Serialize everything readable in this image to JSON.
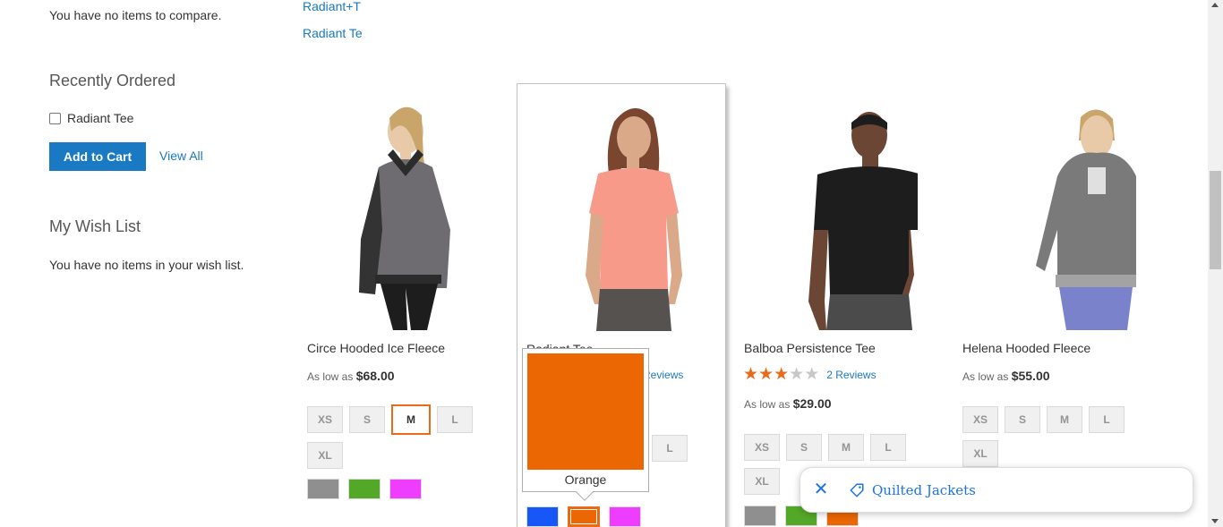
{
  "sidebar": {
    "compare_empty": "You have no items to compare.",
    "recently_ordered": {
      "title": "Recently Ordered",
      "item": "Radiant Tee",
      "add_to_cart": "Add to Cart",
      "view_all": "View All"
    },
    "wishlist": {
      "title": "My Wish List",
      "empty": "You have no items in your wish list."
    }
  },
  "top_links": [
    "Radiant+T",
    "Radiant Te"
  ],
  "products": [
    {
      "name": "Circe Hooded Ice Fleece",
      "price_prefix": "As low as",
      "price": "$68.00",
      "sizes": [
        "XS",
        "S",
        "M",
        "L",
        "XL"
      ],
      "selected_size": "M",
      "colors": [
        "#8f8f8f",
        "#53a828",
        "#ef3dff"
      ]
    },
    {
      "name": "Radiant Tee",
      "reviews": "3 Reviews",
      "sizes": [
        "L"
      ],
      "colors": [
        "#1857f7",
        "#eb6703",
        "#ef3dff"
      ],
      "selected_color": "#eb6703"
    },
    {
      "name": "Balboa Persistence Tee",
      "rating_of_5": 3,
      "reviews": "2 Reviews",
      "price_prefix": "As low as",
      "price": "$29.00",
      "sizes": [
        "XS",
        "S",
        "M",
        "L",
        "XL"
      ],
      "colors": [
        "#8f8f8f",
        "#53a828",
        "#eb6703"
      ]
    },
    {
      "name": "Helena Hooded Fleece",
      "price_prefix": "As low as",
      "price": "$55.00",
      "sizes": [
        "XS",
        "S",
        "M",
        "L",
        "XL"
      ]
    }
  ],
  "tooltip": {
    "label": "Orange",
    "color": "#eb6703"
  },
  "chip": {
    "close_icon": "close-icon",
    "tag_icon": "tag-icon",
    "text": "Quilted Jackets"
  },
  "colors": {
    "accent": "#1979c3",
    "selected": "#e96b1a",
    "chip_text": "#1a73e8"
  }
}
